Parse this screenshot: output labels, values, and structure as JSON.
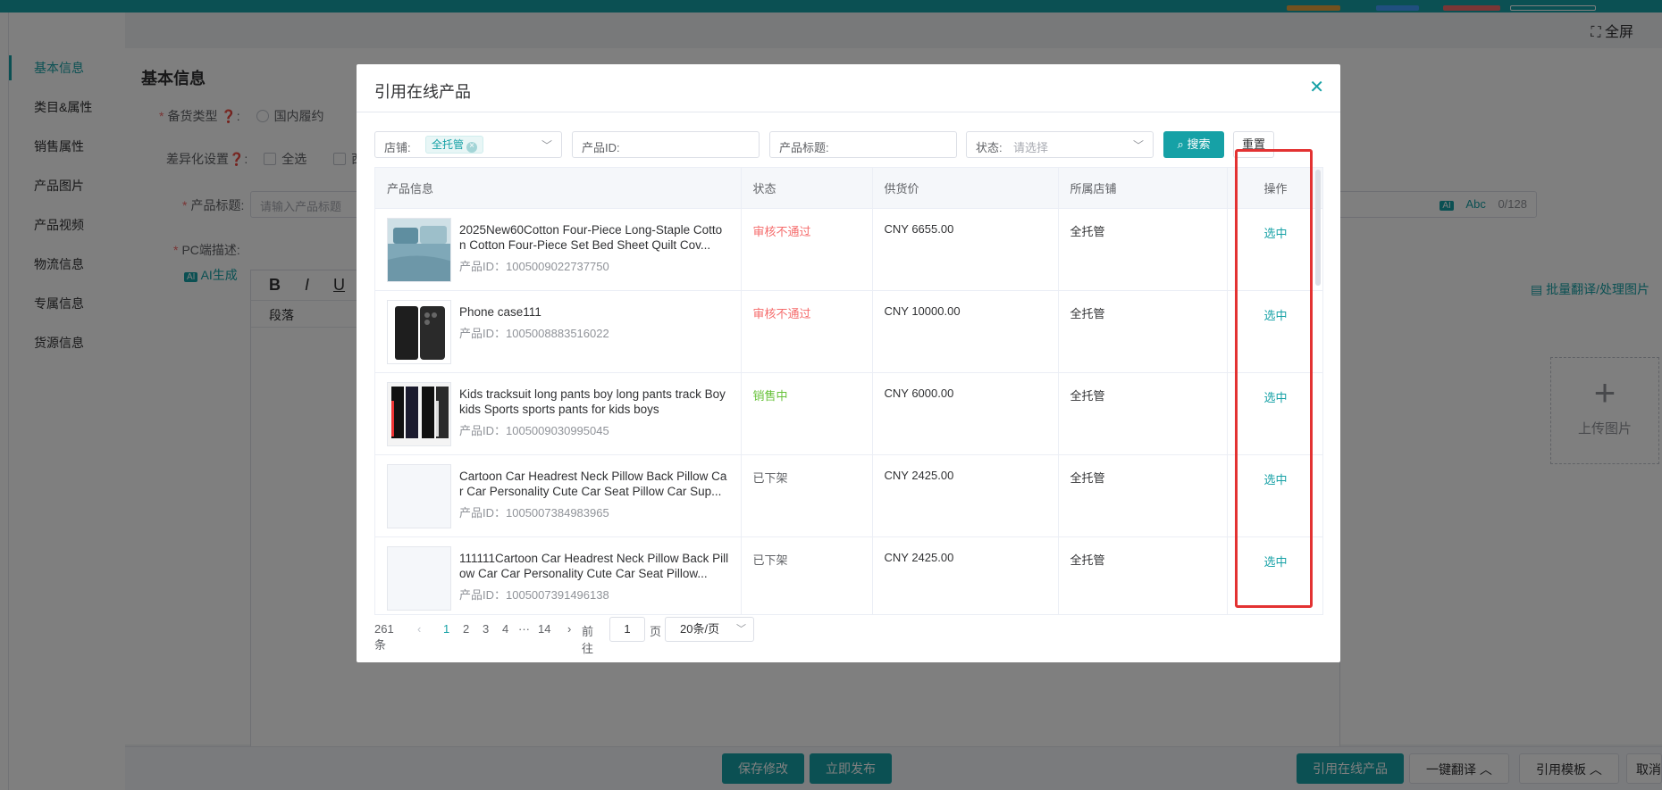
{
  "app": {
    "fullscreen_label": "全屏"
  },
  "sidenav": [
    {
      "label": "基本信息",
      "active": true
    },
    {
      "label": "类目&属性"
    },
    {
      "label": "销售属性"
    },
    {
      "label": "产品图片"
    },
    {
      "label": "产品视频"
    },
    {
      "label": "物流信息"
    },
    {
      "label": "专属信息"
    },
    {
      "label": "货源信息"
    }
  ],
  "form": {
    "section_title": "基本信息",
    "stock_type_label": "备货类型",
    "stock_type_option": "国内履约",
    "diff_label": "差异化设置",
    "diff_all": "全选",
    "diff_west": "西",
    "title_label": "产品标题:",
    "title_placeholder": "请输入产品标题",
    "title_counter": "0/128",
    "title_ai": "AI",
    "title_abc": "Abc",
    "pc_desc_label": "PC端描述:",
    "ai_generate": "AI生成",
    "editor_bold": "B",
    "editor_italic": "I",
    "editor_underline": "U",
    "editor_paragraph": "段落",
    "batch_translate": "批量翻译/处理图片",
    "upload_label": "上传图片"
  },
  "bottom_bar": {
    "save": "保存修改",
    "publish": "立即发布",
    "quote_online": "引用在线产品",
    "one_click_translate": "一键翻译",
    "quote_template": "引用模板",
    "cancel": "取消"
  },
  "modal": {
    "title": "引用在线产品",
    "close_icon": "close-icon",
    "filters": {
      "shop_label": "店铺:",
      "shop_tag": "全托管",
      "product_id_label": "产品ID:",
      "product_title_label": "产品标题:",
      "status_label": "状态:",
      "status_placeholder": "请选择",
      "search_label": "搜索",
      "reset_label": "重置"
    },
    "table": {
      "headers": [
        "产品信息",
        "状态",
        "供货价",
        "所属店铺",
        "操作"
      ],
      "id_prefix": "产品ID：",
      "rows": [
        {
          "title": "2025New60Cotton Four-Piece Long-Staple Cotton Cotton Four-Piece Set Bed Sheet Quilt Cov...",
          "product_id": "1005009022737750",
          "status": "审核不通过",
          "status_color": "#f56c6c",
          "price": "CNY 6655.00",
          "shop": "全托管",
          "action": "选中",
          "thumb": "bedding"
        },
        {
          "title": "Phone case111",
          "product_id": "1005008883516022",
          "status": "审核不通过",
          "status_color": "#f56c6c",
          "price": "CNY 10000.00",
          "shop": "全托管",
          "action": "选中",
          "thumb": "phone-case"
        },
        {
          "title": "Kids tracksuit long pants boy long pants track Boy kids Sports sports pants for kids boys",
          "product_id": "1005009030995045",
          "status": "销售中",
          "status_color": "#67c23a",
          "price": "CNY 6000.00",
          "shop": "全托管",
          "action": "选中",
          "thumb": "pants"
        },
        {
          "title": "Cartoon Car Headrest Neck Pillow Back Pillow Car Car Personality Cute Car Seat Pillow Car Sup...",
          "product_id": "1005007384983965",
          "status": "已下架",
          "status_color": "#606266",
          "price": "CNY 2425.00",
          "shop": "全托管",
          "action": "选中",
          "thumb": "blank"
        },
        {
          "title": "111111Cartoon Car Headrest Neck Pillow Back Pillow Car Car Personality Cute Car Seat Pillow...",
          "product_id": "1005007391496138",
          "status": "已下架",
          "status_color": "#606266",
          "price": "CNY 2425.00",
          "shop": "全托管",
          "action": "选中",
          "thumb": "blank"
        }
      ]
    },
    "pagination": {
      "total": "261条",
      "pages": [
        "1",
        "2",
        "3",
        "4"
      ],
      "current": "1",
      "ellipsis": "···",
      "last": "14",
      "goto_label": "前往",
      "goto_value": "1",
      "page_unit": "页",
      "page_size": "20条/页"
    }
  },
  "colors": {
    "accent": "#16a1a6",
    "danger": "#f56c6c",
    "success": "#67c23a",
    "highlight": "#e33232"
  }
}
